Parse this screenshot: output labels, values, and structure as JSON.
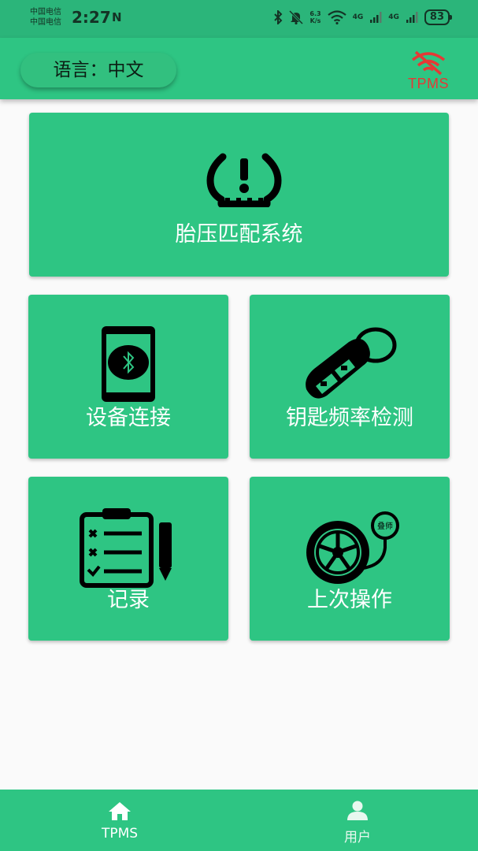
{
  "status_bar": {
    "carrier_1": "中国电信",
    "carrier_2": "中国电信",
    "time": "2:27",
    "nfc_icon": "N",
    "speed_value": "6.3",
    "speed_unit": "K/s",
    "network_1": "4G",
    "network_2": "4G",
    "battery": "83"
  },
  "header": {
    "language_button": "语言：中文",
    "logo_text": "TPMS",
    "logo_icon": "wifi-off-icon"
  },
  "tiles": {
    "tpms_match": {
      "label": "胎压匹配系统",
      "icon": "tire-pressure-warning-icon"
    },
    "device_connect": {
      "label": "设备连接",
      "icon": "phone-bluetooth-icon"
    },
    "key_frequency": {
      "label": "钥匙频率检测",
      "icon": "car-key-fob-icon"
    },
    "records": {
      "label": "记录",
      "icon": "checklist-clipboard-icon"
    },
    "last_operation": {
      "label": "上次操作",
      "icon": "wheel-gauge-icon",
      "gauge_text": "叠师"
    }
  },
  "bottom_nav": {
    "items": [
      {
        "label": "TPMS",
        "icon": "home-icon",
        "active": true
      },
      {
        "label": "用户",
        "icon": "user-icon",
        "active": false
      }
    ]
  },
  "colors": {
    "primary": "#2ec583",
    "status_bar": "#2bb57a",
    "logo_red": "#e53935",
    "background": "#fafafa"
  }
}
